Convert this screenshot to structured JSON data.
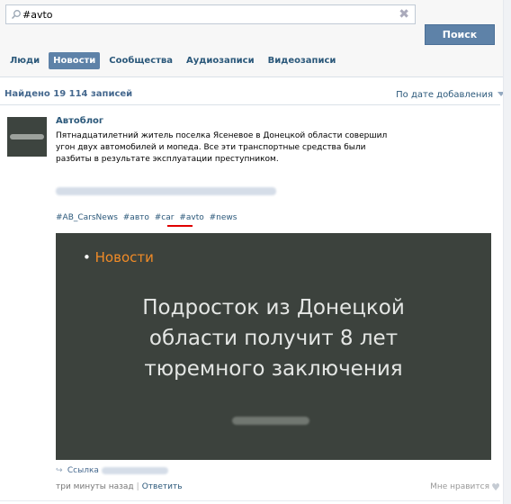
{
  "search": {
    "value": "#avto",
    "clear_glyph": "✖",
    "button_label": "Поиск"
  },
  "tabs": [
    {
      "label": "Люди",
      "active": false
    },
    {
      "label": "Новости",
      "active": true
    },
    {
      "label": "Сообщества",
      "active": false
    },
    {
      "label": "Аудиозаписи",
      "active": false
    },
    {
      "label": "Видеозаписи",
      "active": false
    }
  ],
  "results": {
    "count_label": "Найдено 19 114 записей",
    "sort_label": "По дате добавления"
  },
  "post": {
    "author": "Автоблог",
    "text": "Пятнадцатилетний житель поселка Ясеневое в Донецкой области совершил угон двух автомобилей и мопеда. Все эти транспортные средства были разбиты в результате эксплуатации преступником.",
    "hashtags": [
      "#AB_CarsNews",
      "#авто",
      "#car",
      "#avto",
      "#news"
    ],
    "preview": {
      "category": "Новости",
      "bullet": "•",
      "headline_lines": [
        "Подросток из Донецкой",
        "области получит 8 лет",
        "тюремного заключения"
      ]
    },
    "link_label": "Ссылка",
    "timestamp": "три минуты назад",
    "separator": "|",
    "reply_label": "Ответить",
    "like_label": "Мне нравится"
  },
  "colors": {
    "accent": "#5e82a8",
    "link": "#2b587a",
    "preview_bg": "#3c423d",
    "category": "#f18b27",
    "underline": "#e00000"
  }
}
